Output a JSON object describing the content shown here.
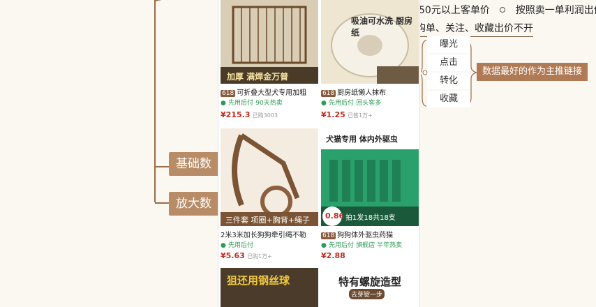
{
  "mindmap": {
    "node_basic": "基础数",
    "node_amplify": "放大数",
    "top_line1_prefix": "50元以上客单价",
    "top_line1_suffix": "按照卖一单利润出价",
    "top_line2": "购单、关注、收藏出价不开",
    "metrics": [
      "曝光",
      "点击",
      "转化",
      "收藏"
    ],
    "summary": "数据最好的作为主推链接"
  },
  "products": [
    {
      "banner": "加厚 满焊金万普",
      "rank": "618",
      "title": "可折叠大型犬专用加粗",
      "badge": "先用后付",
      "sales": "90天热卖",
      "price": "215.3",
      "meta": "已购3003",
      "colors": {
        "bg": "#d9cdb6",
        "accent": "#6b4a2a"
      }
    },
    {
      "banner": "吸油可水洗 厨房纸",
      "rank": "618",
      "title": "厨房纸懒人抹布",
      "badge": "先用后付",
      "sales": "回头客多",
      "price": "1.25",
      "meta": "已售1万+",
      "colors": {
        "bg": "#efe6d2",
        "accent": "#3b3b3b"
      }
    },
    {
      "banner": "三件套 项圈+胸背+绳子",
      "rank": "",
      "title": "2米3米加长狗狗牵引绳不勒",
      "badge": "先用后付",
      "sales": "",
      "price": "5.63",
      "meta": "已购1万+",
      "colors": {
        "bg": "#f4ece0",
        "accent": "#7a5434"
      }
    },
    {
      "banner": "犬猫专用 体内外驱虫",
      "rank": "618",
      "title": "狗狗体外驱虫药猫",
      "badge": "先用后付",
      "sales": "旗舰店 半年热卖",
      "price": "2.88",
      "meta": "拍1发18共18支",
      "price_tag": "0.86",
      "colors": {
        "bg": "#2aa06c",
        "accent": "#e94c2c"
      }
    },
    {
      "banner": "狙还用钢丝球",
      "rank": "",
      "title": "",
      "badge": "",
      "sales": "",
      "price": "",
      "meta": "",
      "colors": {
        "bg": "#4a3b2a",
        "accent": "#e0b840"
      }
    },
    {
      "banner": "特有螺旋造型",
      "rank": "",
      "title": "",
      "badge": "",
      "sales": "",
      "price": "",
      "meta": "去芽锭一步",
      "colors": {
        "bg": "#ffffff",
        "accent": "#2a2a2a"
      }
    }
  ]
}
